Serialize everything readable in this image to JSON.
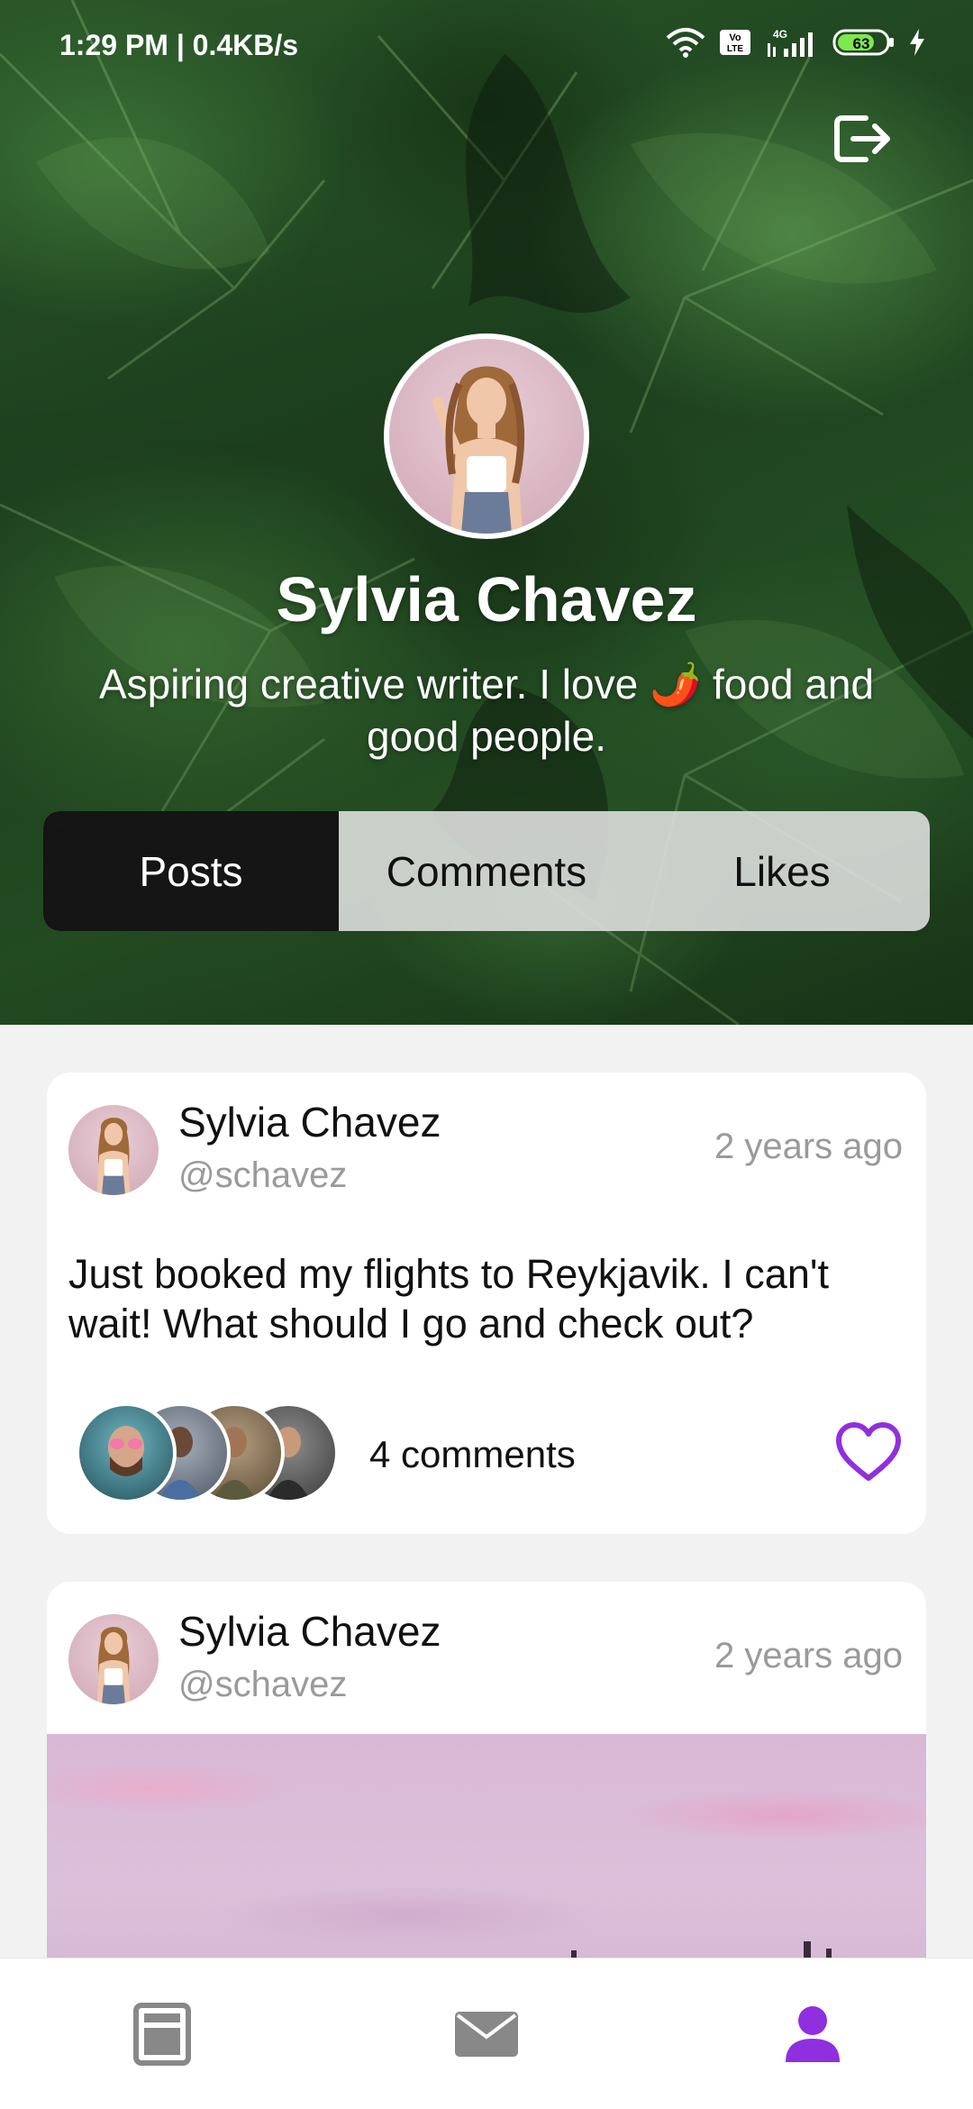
{
  "status_bar": {
    "time": "1:29 PM | 0.4KB/s",
    "battery": "63",
    "icons": [
      "wifi-icon",
      "volte-icon",
      "signal-4g-icon",
      "battery-icon",
      "charging-icon"
    ]
  },
  "header": {
    "logout_icon": "logout-icon"
  },
  "profile": {
    "name": "Sylvia Chavez",
    "bio": "Aspiring creative writer. I love 🌶️ food and good people."
  },
  "tabs": [
    {
      "label": "Posts",
      "active": true
    },
    {
      "label": "Comments",
      "active": false
    },
    {
      "label": "Likes",
      "active": false
    }
  ],
  "posts": [
    {
      "author": "Sylvia Chavez",
      "handle": "@schavez",
      "time": "2 years ago",
      "text": "Just booked my flights to Reykjavik. I can't wait! What should I go and check out?",
      "comments": "4 comments"
    },
    {
      "author": "Sylvia Chavez",
      "handle": "@schavez",
      "time": "2 years ago"
    }
  ],
  "bottom_nav": [
    {
      "icon": "feed-icon",
      "active": false
    },
    {
      "icon": "mail-icon",
      "active": false
    },
    {
      "icon": "profile-icon",
      "active": true
    }
  ],
  "colors": {
    "accent": "#8f2fe0",
    "nav_inactive": "#888888",
    "leaf_green": "#2c5b2a"
  }
}
